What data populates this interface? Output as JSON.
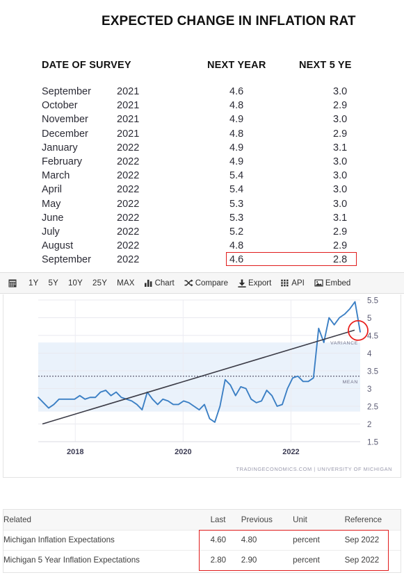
{
  "document": {
    "title": "EXPECTED CHANGE IN INFLATION RAT"
  },
  "survey_table": {
    "headers": {
      "date": "DATE OF SURVEY",
      "next_year": "NEXT YEAR",
      "next_5_years": "NEXT 5 YE"
    },
    "rows": [
      {
        "month": "September",
        "year": "2021",
        "next_year": "4.6",
        "next_5_years": "3.0"
      },
      {
        "month": "October",
        "year": "2021",
        "next_year": "4.8",
        "next_5_years": "2.9"
      },
      {
        "month": "November",
        "year": "2021",
        "next_year": "4.9",
        "next_5_years": "3.0"
      },
      {
        "month": "December",
        "year": "2021",
        "next_year": "4.8",
        "next_5_years": "2.9"
      },
      {
        "month": "January",
        "year": "2022",
        "next_year": "4.9",
        "next_5_years": "3.1"
      },
      {
        "month": "February",
        "year": "2022",
        "next_year": "4.9",
        "next_5_years": "3.0"
      },
      {
        "month": "March",
        "year": "2022",
        "next_year": "5.4",
        "next_5_years": "3.0"
      },
      {
        "month": "April",
        "year": "2022",
        "next_year": "5.4",
        "next_5_years": "3.0"
      },
      {
        "month": "May",
        "year": "2022",
        "next_year": "5.3",
        "next_5_years": "3.0"
      },
      {
        "month": "June",
        "year": "2022",
        "next_year": "5.3",
        "next_5_years": "3.1"
      },
      {
        "month": "July",
        "year": "2022",
        "next_year": "5.2",
        "next_5_years": "2.9"
      },
      {
        "month": "August",
        "year": "2022",
        "next_year": "4.8",
        "next_5_years": "2.9"
      },
      {
        "month": "September",
        "year": "2022",
        "next_year": "4.6",
        "next_5_years": "2.8"
      }
    ],
    "highlight_color": "#e01b1b"
  },
  "toolbar": {
    "calendar_icon": "calendar-icon",
    "ranges": [
      "1Y",
      "5Y",
      "10Y",
      "25Y",
      "MAX"
    ],
    "actions": [
      {
        "label": "Chart",
        "icon": "bar-chart-icon"
      },
      {
        "label": "Compare",
        "icon": "shuffle-icon"
      },
      {
        "label": "Export",
        "icon": "download-icon"
      },
      {
        "label": "API",
        "icon": "grid-icon"
      },
      {
        "label": "Embed",
        "icon": "image-icon"
      }
    ]
  },
  "chart_data": {
    "type": "line",
    "title": "",
    "xlabel": "",
    "ylabel": "",
    "ylim": [
      1.5,
      5.5
    ],
    "y_ticks": [
      "1.5",
      "2",
      "2.5",
      "3",
      "3.5",
      "4",
      "4.5",
      "5",
      "5.5"
    ],
    "x_ticks": [
      "2018",
      "2020",
      "2022"
    ],
    "grid": true,
    "legend_position": "none",
    "line_color": "#3b7fc4",
    "trend_color": "#3b3b46",
    "band_color": "#eaf2fb",
    "annotations": [
      {
        "label": "VARIANCE",
        "y": 4.25
      },
      {
        "label": "MEAN",
        "y": 3.15
      }
    ],
    "mean_value": 3.35,
    "variance_band": [
      2.35,
      4.3
    ],
    "highlight_circle": {
      "x_label": "Sep 2022",
      "value": 4.6,
      "color": "#e8201e"
    },
    "credit": "TRADINGECONOMICS.COM  |  UNIVERSITY OF MICHIGAN",
    "series": [
      {
        "name": "Michigan Inflation Expectations",
        "x": [
          "2017-07",
          "2017-08",
          "2017-09",
          "2017-10",
          "2017-11",
          "2017-12",
          "2018-01",
          "2018-02",
          "2018-03",
          "2018-04",
          "2018-05",
          "2018-06",
          "2018-07",
          "2018-08",
          "2018-09",
          "2018-10",
          "2018-11",
          "2018-12",
          "2019-01",
          "2019-02",
          "2019-03",
          "2019-04",
          "2019-05",
          "2019-06",
          "2019-07",
          "2019-08",
          "2019-09",
          "2019-10",
          "2019-11",
          "2019-12",
          "2020-01",
          "2020-02",
          "2020-03",
          "2020-04",
          "2020-05",
          "2020-06",
          "2020-07",
          "2020-08",
          "2020-09",
          "2020-10",
          "2020-11",
          "2020-12",
          "2021-01",
          "2021-02",
          "2021-03",
          "2021-04",
          "2021-05",
          "2021-06",
          "2021-07",
          "2021-08",
          "2021-09",
          "2021-10",
          "2021-11",
          "2021-12",
          "2022-01",
          "2022-02",
          "2022-03",
          "2022-04",
          "2022-05",
          "2022-06",
          "2022-07",
          "2022-08",
          "2022-09"
        ],
        "values": [
          2.75,
          2.6,
          2.45,
          2.55,
          2.7,
          2.7,
          2.7,
          2.7,
          2.8,
          2.7,
          2.75,
          2.75,
          2.9,
          2.95,
          2.8,
          2.9,
          2.75,
          2.7,
          2.65,
          2.55,
          2.4,
          2.9,
          2.7,
          2.55,
          2.7,
          2.65,
          2.55,
          2.55,
          2.65,
          2.6,
          2.5,
          2.4,
          2.55,
          2.15,
          2.05,
          2.5,
          3.25,
          3.1,
          2.8,
          3.05,
          3.0,
          2.7,
          2.6,
          2.65,
          2.95,
          2.8,
          2.5,
          2.55,
          3.0,
          3.3,
          3.35,
          3.2,
          3.2,
          3.3,
          4.7,
          4.3,
          5.0,
          4.8,
          5.0,
          5.1,
          5.25,
          5.45,
          4.6
        ]
      }
    ],
    "trend_line": {
      "start": 2.0,
      "end": 4.65
    }
  },
  "related_table": {
    "headers": [
      "Related",
      "Last",
      "Previous",
      "Unit",
      "Reference"
    ],
    "rows": [
      {
        "name": "Michigan Inflation Expectations",
        "last": "4.60",
        "previous": "4.80",
        "unit": "percent",
        "reference": "Sep 2022"
      },
      {
        "name": "Michigan 5 Year Inflation Expectations",
        "last": "2.80",
        "previous": "2.90",
        "unit": "percent",
        "reference": "Sep 2022"
      }
    ],
    "highlight_color": "#e01b1b"
  }
}
